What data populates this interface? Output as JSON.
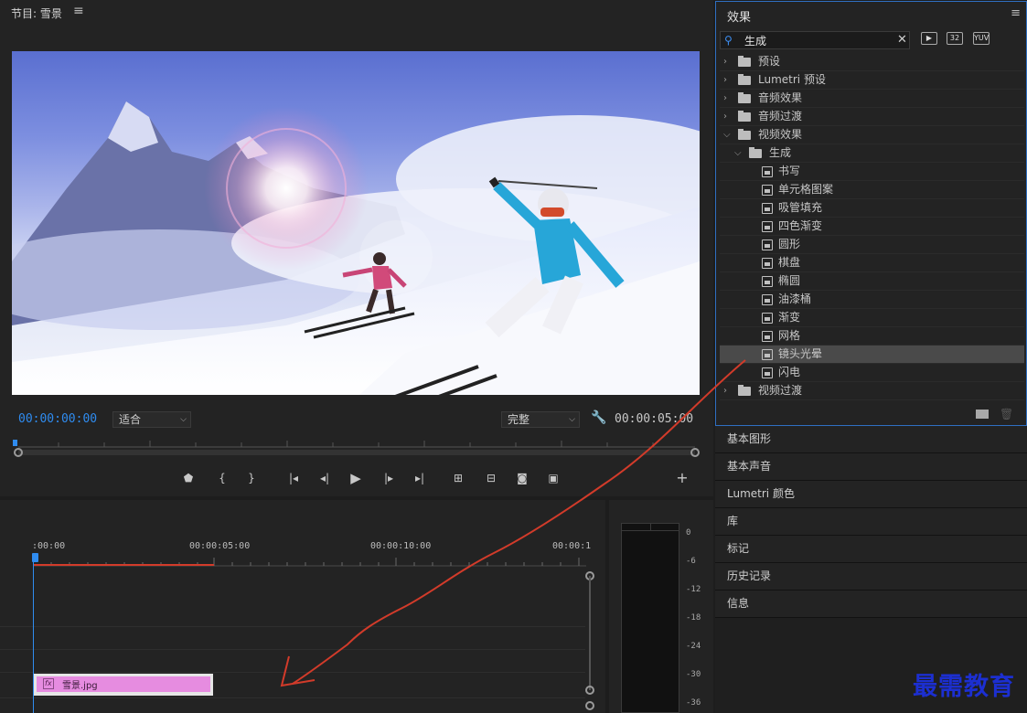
{
  "monitor": {
    "title": "节目: 雪景",
    "timecode_current": "00:00:00:00",
    "timecode_duration": "00:00:05:00",
    "fit_value": "适合",
    "quality_value": "完整"
  },
  "effects": {
    "title": "效果",
    "search_value": "生成",
    "badges": [
      "32",
      "YUV"
    ],
    "tree": [
      {
        "label": "预设",
        "kind": "folder",
        "level": 0,
        "expanded": false
      },
      {
        "label": "Lumetri 预设",
        "kind": "folder",
        "level": 0,
        "expanded": false
      },
      {
        "label": "音频效果",
        "kind": "folder",
        "level": 0,
        "expanded": false
      },
      {
        "label": "音频过渡",
        "kind": "folder",
        "level": 0,
        "expanded": false
      },
      {
        "label": "视频效果",
        "kind": "folder",
        "level": 0,
        "expanded": true
      },
      {
        "label": "生成",
        "kind": "folder",
        "level": 1,
        "expanded": true
      },
      {
        "label": "书写",
        "kind": "effect",
        "level": 2
      },
      {
        "label": "单元格图案",
        "kind": "effect",
        "level": 2
      },
      {
        "label": "吸管填充",
        "kind": "effect",
        "level": 2
      },
      {
        "label": "四色渐变",
        "kind": "effect",
        "level": 2
      },
      {
        "label": "圆形",
        "kind": "effect",
        "level": 2
      },
      {
        "label": "棋盘",
        "kind": "effect",
        "level": 2
      },
      {
        "label": "椭圆",
        "kind": "effect",
        "level": 2
      },
      {
        "label": "油漆桶",
        "kind": "effect",
        "level": 2
      },
      {
        "label": "渐变",
        "kind": "effect",
        "level": 2
      },
      {
        "label": "网格",
        "kind": "effect",
        "level": 2
      },
      {
        "label": "镜头光晕",
        "kind": "effect",
        "level": 2,
        "selected": true
      },
      {
        "label": "闪电",
        "kind": "effect",
        "level": 2
      },
      {
        "label": "视频过渡",
        "kind": "folder",
        "level": 0,
        "expanded": false
      }
    ]
  },
  "side_panels": [
    "基本图形",
    "基本声音",
    "Lumetri 颜色",
    "库",
    "标记",
    "历史记录",
    "信息"
  ],
  "timeline": {
    "ruler_labels": [
      ":00:00",
      "00:00:05:00",
      "00:00:10:00",
      "00:00:1"
    ],
    "clip": {
      "name": "雪景.jpg",
      "fx_label": "fx",
      "color": "#e68ce0"
    }
  },
  "meters": {
    "scale": [
      "0",
      "-6",
      "-12",
      "-18",
      "-24",
      "-30",
      "-36"
    ]
  },
  "watermark": "最需教育",
  "colors": {
    "accent": "#2f8cf0",
    "annotation": "#d23b2a",
    "clip": "#e68ce0"
  }
}
